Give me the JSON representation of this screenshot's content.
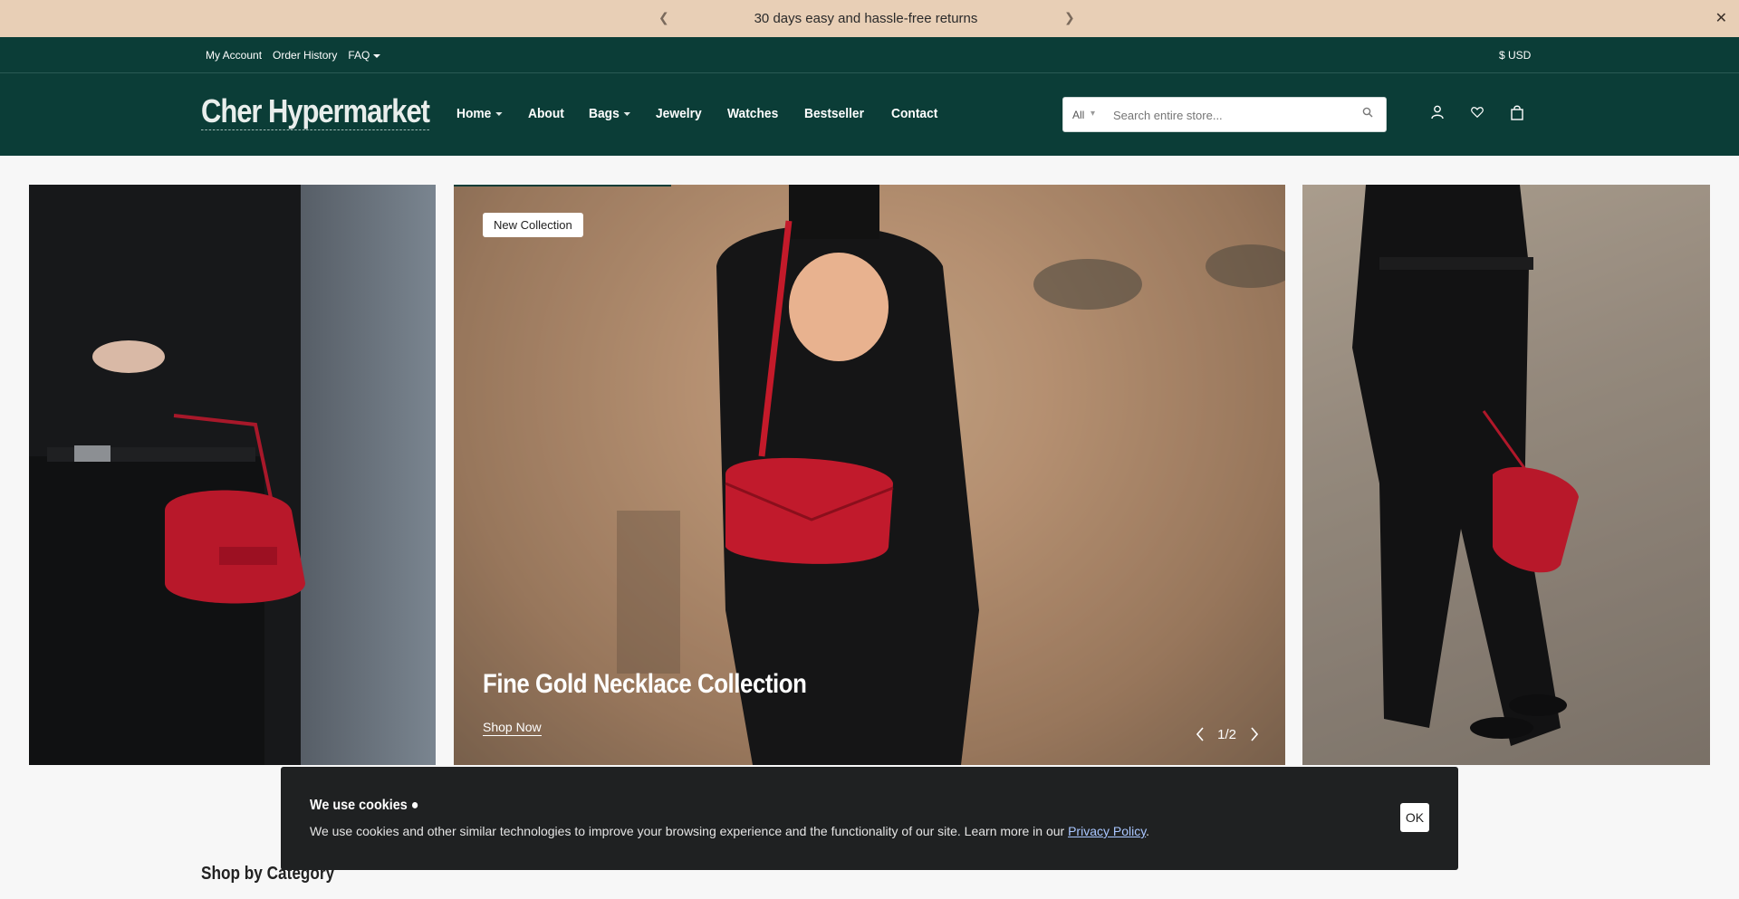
{
  "announcement": {
    "text": "30 days easy and hassle-free returns",
    "prev_icon": "chevron-left-icon",
    "next_icon": "chevron-right-icon",
    "close_icon": "close-icon"
  },
  "util_bar": {
    "links": [
      "My Account",
      "Order History",
      "FAQ"
    ],
    "currency": "$ USD"
  },
  "header": {
    "logo": "Cher Hypermarket",
    "nav": [
      {
        "label": "Home",
        "has_dropdown": true
      },
      {
        "label": "About",
        "has_dropdown": false
      },
      {
        "label": "Bags",
        "has_dropdown": true
      },
      {
        "label": "Jewelry",
        "has_dropdown": false
      },
      {
        "label": "Watches",
        "has_dropdown": false
      },
      {
        "label": "Bestseller",
        "has_dropdown": false
      },
      {
        "label": "Contact",
        "has_dropdown": false
      }
    ],
    "search": {
      "category": "All",
      "placeholder": "Search entire store...",
      "value": ""
    },
    "icons": [
      "user-icon",
      "heart-icon",
      "bag-icon"
    ]
  },
  "slider": {
    "badge": "New Collection",
    "title": "Fine Gold Necklace Collection",
    "cta": "Shop Now",
    "pager": "1/2",
    "progress": 0.26
  },
  "cookie": {
    "title": "We use cookies",
    "body": "We use cookies and other similar technologies to improve your browsing experience and the functionality of our site. Learn more in our ",
    "link": "Privacy Policy",
    "ok": "OK"
  },
  "section": {
    "title": "Shop by Category"
  },
  "colors": {
    "brand": "#0b3d37",
    "announcement_bg": "#e8cfb6",
    "cookie_bg": "#1f2122"
  }
}
